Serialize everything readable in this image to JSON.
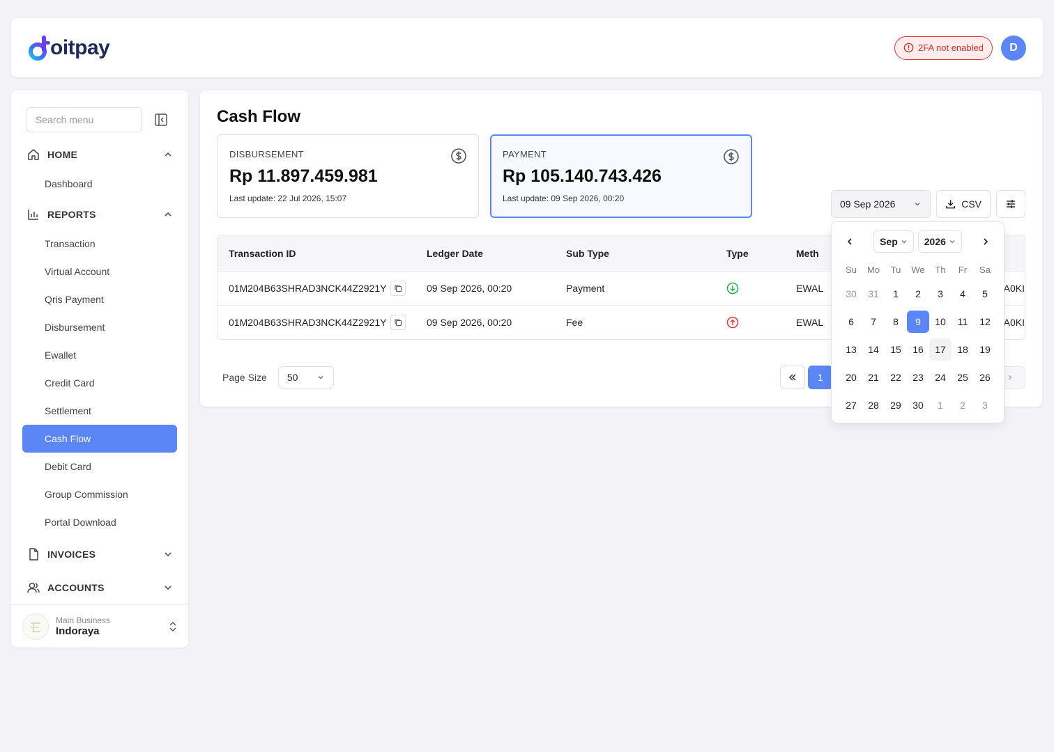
{
  "header": {
    "logo_text": "oitpay",
    "twofa_label": "2FA not enabled",
    "user_initial": "D"
  },
  "sidebar": {
    "search_placeholder": "Search menu",
    "sections": [
      {
        "label": "HOME",
        "items": [
          "Dashboard"
        ]
      },
      {
        "label": "REPORTS",
        "items": [
          "Transaction",
          "Virtual Account",
          "Qris Payment",
          "Disbursement",
          "Ewallet",
          "Credit Card",
          "Settlement",
          "Cash Flow",
          "Debit Card",
          "Group Commission",
          "Portal Download"
        ]
      },
      {
        "label": "INVOICES"
      },
      {
        "label": "ACCOUNTS"
      }
    ],
    "active_item": "Cash Flow",
    "business": {
      "label": "Main Business",
      "name": "Indoraya"
    }
  },
  "main": {
    "title": "Cash Flow",
    "disbursement": {
      "label": "DISBURSEMENT",
      "value": "Rp 11.897.459.981",
      "update": "Last update: 22 Jul 2026, 15:07"
    },
    "payment": {
      "label": "PAYMENT",
      "value": "Rp 105.140.743.426",
      "update": "Last update: 09 Sep 2026, 00:20"
    },
    "date_filter": "09 Sep 2026",
    "csv_label": "CSV",
    "table": {
      "headers": [
        "Transaction ID",
        "Ledger Date",
        "Sub Type",
        "Type",
        "Meth"
      ],
      "rows": [
        {
          "id": "01M204B63SHRAD3NCK44Z2921Y",
          "date": "09 Sep 2026, 00:20",
          "subtype": "Payment",
          "type": "in",
          "method": "EWAL",
          "trailing": "A0KI"
        },
        {
          "id": "01M204B63SHRAD3NCK44Z2921Y",
          "date": "09 Sep 2026, 00:20",
          "subtype": "Fee",
          "type": "out",
          "method": "EWAL",
          "trailing": "A0KI"
        }
      ]
    },
    "page_size_label": "Page Size",
    "page_size_value": "50",
    "current_page": "1"
  },
  "calendar": {
    "month": "Sep",
    "year": "2026",
    "weekdays": [
      "Su",
      "Mo",
      "Tu",
      "We",
      "Th",
      "Fr",
      "Sa"
    ],
    "days": [
      [
        "30",
        "31",
        "1",
        "2",
        "3",
        "4",
        "5"
      ],
      [
        "6",
        "7",
        "8",
        "9",
        "10",
        "11",
        "12"
      ],
      [
        "13",
        "14",
        "15",
        "16",
        "17",
        "18",
        "19"
      ],
      [
        "20",
        "21",
        "22",
        "23",
        "24",
        "25",
        "26"
      ],
      [
        "27",
        "28",
        "29",
        "30",
        "1",
        "2",
        "3"
      ]
    ],
    "selected_day": "9",
    "today_day": "17"
  },
  "colors": {
    "accent": "#5b86f5",
    "danger": "#e53935",
    "success": "#22b14c",
    "brand_navy": "#1f2a56"
  }
}
